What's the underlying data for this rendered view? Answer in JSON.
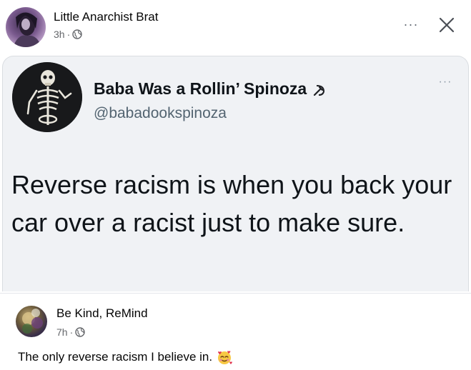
{
  "post": {
    "author": "Little Anarchist Brat",
    "time": "3h",
    "separator": "·",
    "privacy_icon": "globe-icon",
    "more_label": "···",
    "close_icon": "close-icon"
  },
  "tweet": {
    "name": "Baba Was a Rollin’ Spinoza",
    "name_icon": "hammer-sickle-icon",
    "handle": "@babadookspinoza",
    "more_label": "···",
    "text": "Reverse racism is when you back your car over a racist just to make sure."
  },
  "comment": {
    "author": "Be Kind, ReMind",
    "time": "7h",
    "separator": "·",
    "privacy_icon": "globe-icon",
    "text": "The only reverse racism I believe in.",
    "emoji_icon": "smiling-face-with-hearts-icon"
  },
  "colors": {
    "card_bg": "#f0f2f5",
    "secondary_text": "#65676b",
    "handle_text": "#536471"
  }
}
